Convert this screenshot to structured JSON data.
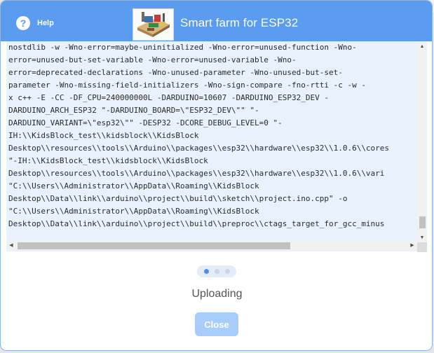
{
  "header": {
    "help_label": "Help",
    "help_glyph": "?",
    "title": "Smart farm for ESP32",
    "icons": [
      "help-icon",
      "device-thumbnail"
    ]
  },
  "log": {
    "lines": [
      "nostdlib -w -Wno-error=maybe-uninitialized -Wno-error=unused-function -Wno-",
      "error=unused-but-set-variable -Wno-error=unused-variable -Wno-",
      "error=deprecated-declarations -Wno-unused-parameter -Wno-unused-but-set-",
      "parameter -Wno-missing-field-initializers -Wno-sign-compare -fno-rtti -c -w -",
      "x c++ -E -CC -DF_CPU=240000000L -DARDUINO=10607 -DARDUINO_ESP32_DEV -",
      "DARDUINO_ARCH_ESP32 \"-DARDUINO_BOARD=\\\"ESP32_DEV\\\"\" \"-",
      "DARDUINO_VARIANT=\\\"esp32\\\"\" -DESP32 -DCORE_DEBUG_LEVEL=0 \"-",
      "IH:\\\\KidsBlock_test\\\\kidsblock\\\\KidsBlock",
      "Desktop\\\\resources\\\\tools\\\\Arduino\\\\packages\\\\esp32\\\\hardware\\\\esp32\\\\1.0.6\\\\cores",
      "\"-IH:\\\\KidsBlock_test\\\\kidsblock\\\\KidsBlock",
      "Desktop\\\\resources\\\\tools\\\\Arduino\\\\packages\\\\esp32\\\\hardware\\\\esp32\\\\1.0.6\\\\vari",
      "\"C:\\\\Users\\\\Administrator\\\\AppData\\\\Roaming\\\\KidsBlock",
      "Desktop\\\\Data\\\\link\\\\arduino\\\\project\\\\build\\\\sketch\\\\project.ino.cpp\" -o",
      "\"C:\\\\Users\\\\Administrator\\\\AppData\\\\Roaming\\\\KidsBlock",
      "Desktop\\\\Data\\\\link\\\\arduino\\\\project\\\\build\\\\preproc\\\\ctags_target_for_gcc_minus"
    ]
  },
  "progress": {
    "steps_total": 3,
    "active_step": 1,
    "status_text": "Uploading"
  },
  "actions": {
    "close_label": "Close"
  },
  "colors": {
    "header": "#5b9cf0",
    "log_background": "#e9f1fd",
    "close_button": "#a9cdfa",
    "active_dot": "#4d8fe8"
  }
}
